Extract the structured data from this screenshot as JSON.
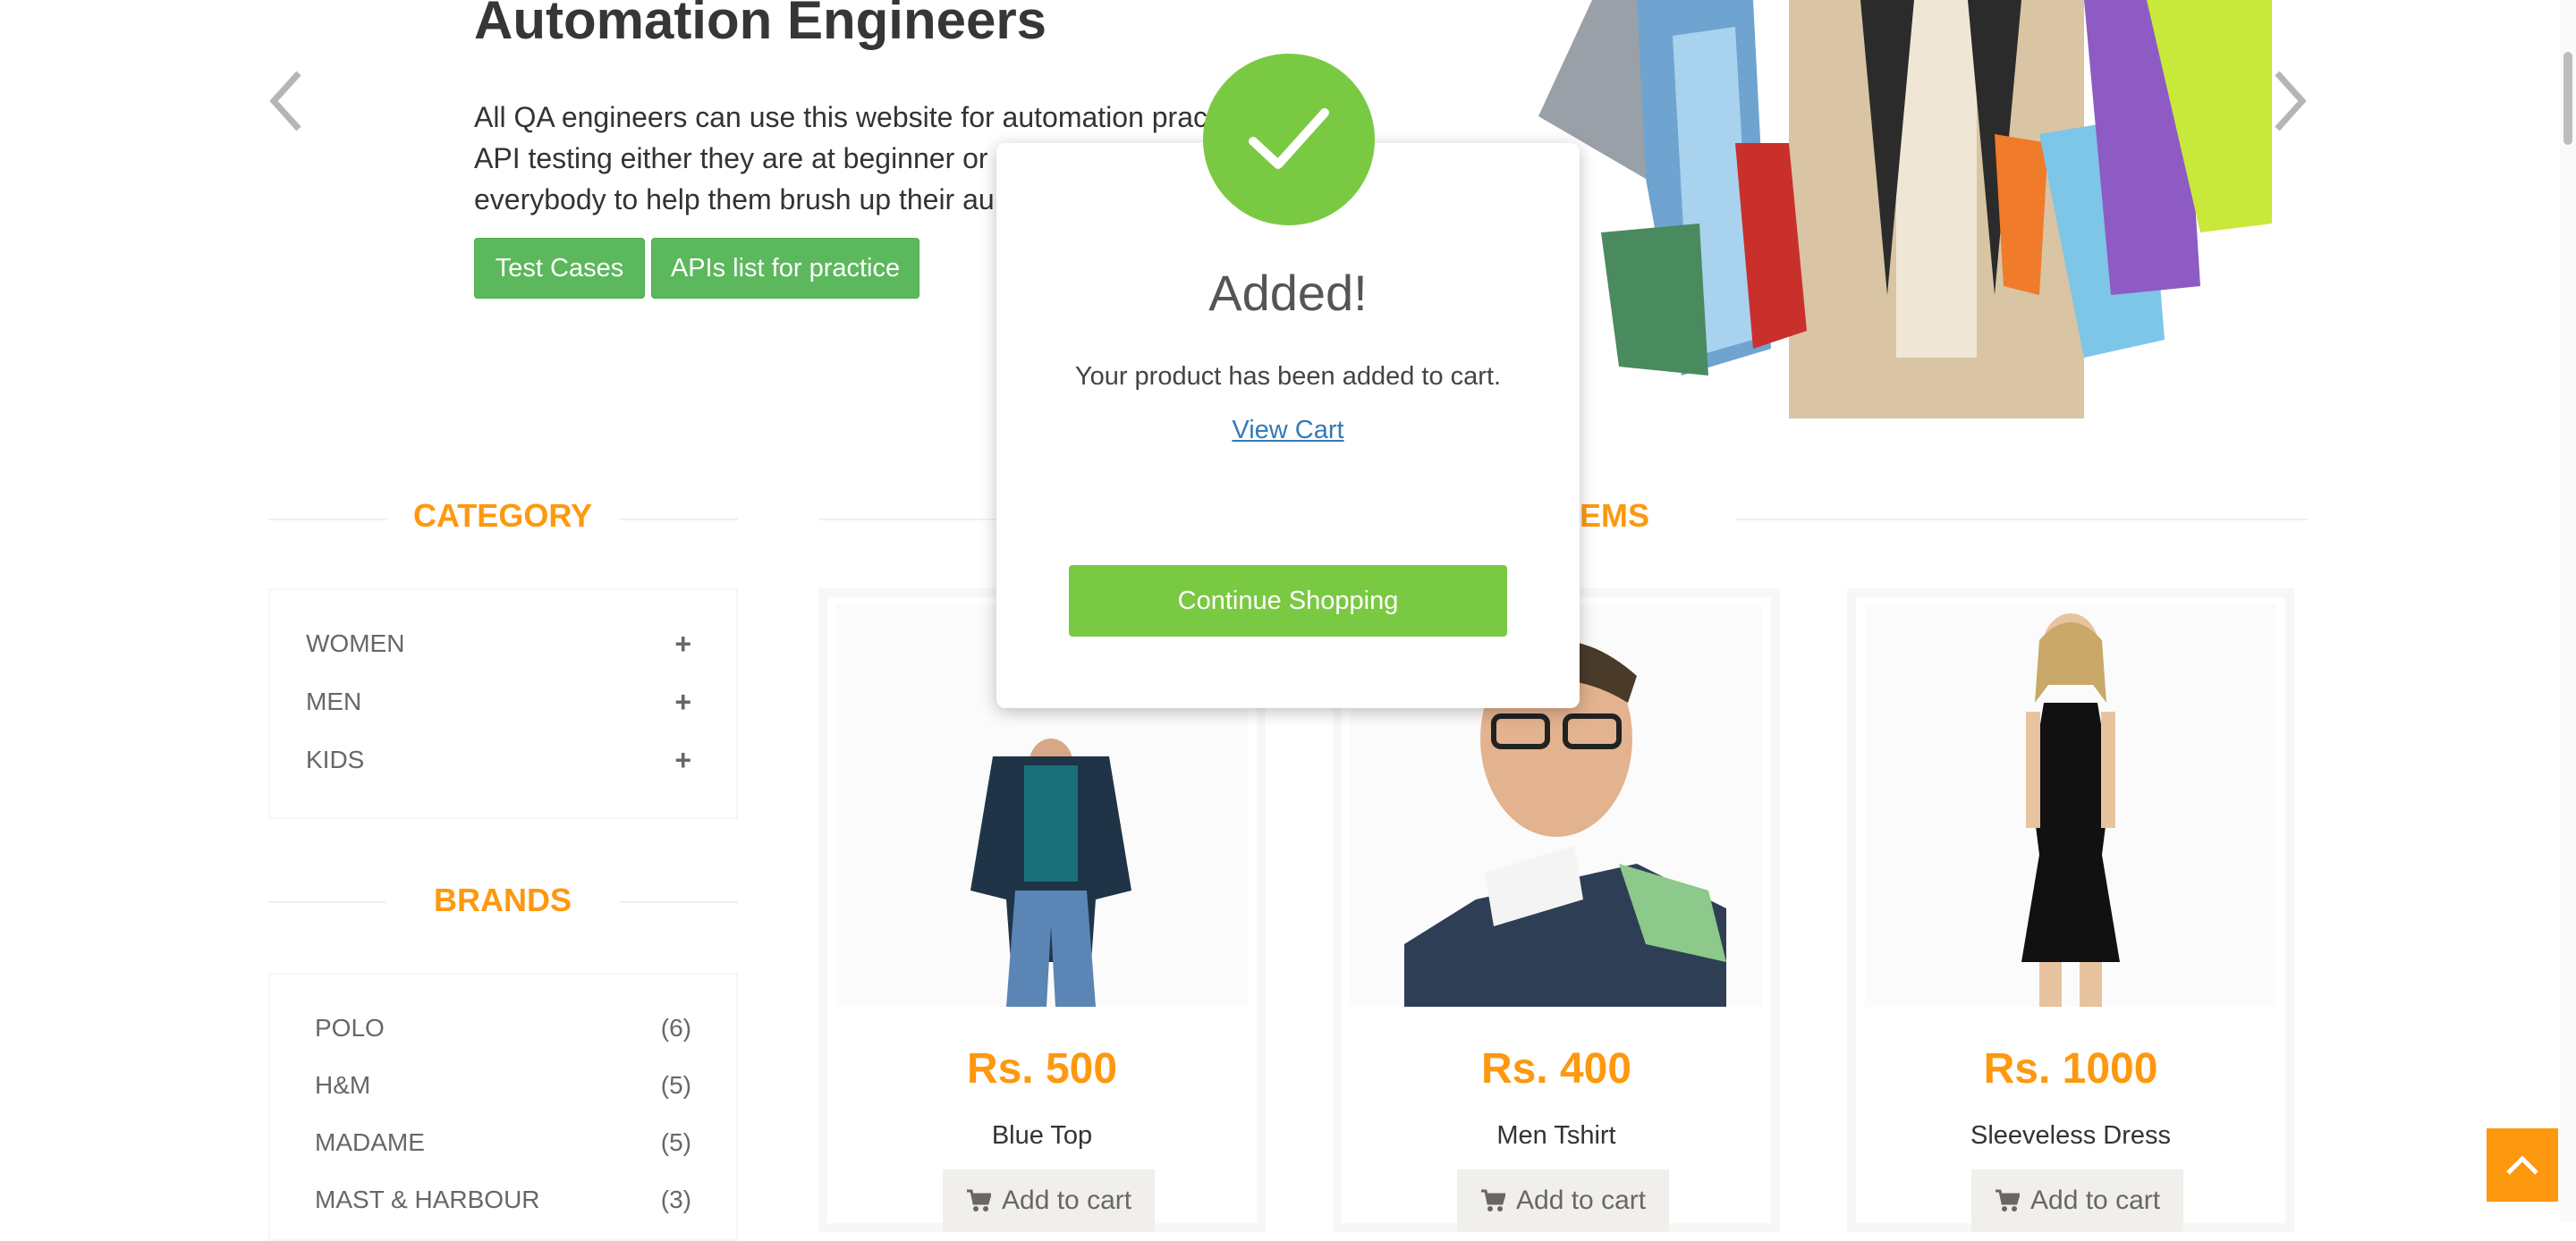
{
  "hero": {
    "title": "Automation Engineers",
    "lines": [
      "All QA engineers can use this website for automation prac",
      "API testing either they are at beginner or",
      "everybody to help them brush up their au"
    ],
    "btn_test_cases": "Test Cases",
    "btn_apis": "APIs list for practice"
  },
  "sidebar": {
    "category_title": "CATEGORY",
    "categories": [
      {
        "label": "WOMEN",
        "icon": "+"
      },
      {
        "label": "MEN",
        "icon": "+"
      },
      {
        "label": "KIDS",
        "icon": "+"
      }
    ],
    "brands_title": "BRANDS",
    "brands": [
      {
        "label": "POLO",
        "count": "(6)"
      },
      {
        "label": "H&M",
        "count": "(5)"
      },
      {
        "label": "MADAME",
        "count": "(5)"
      },
      {
        "label": "MAST & HARBOUR",
        "count": "(3)"
      }
    ]
  },
  "features": {
    "title_fragment": "S ITEMS"
  },
  "products": [
    {
      "price": "Rs. 500",
      "name": "Blue Top",
      "add_label": "Add to cart"
    },
    {
      "price": "Rs. 400",
      "name": "Men Tshirt",
      "add_label": "Add to cart"
    },
    {
      "price": "Rs. 1000",
      "name": "Sleeveless Dress",
      "add_label": "Add to cart"
    }
  ],
  "modal": {
    "title": "Added!",
    "message": "Your product has been added to cart.",
    "link": "View Cart",
    "button": "Continue Shopping"
  },
  "colors": {
    "accent_orange": "#fe980f",
    "green_button": "#5cb85c",
    "modal_green": "#7ac943",
    "link_blue": "#337ab7"
  },
  "icons": {
    "prev": "chevron-left-icon",
    "next": "chevron-right-icon",
    "success": "checkmark-icon",
    "cart": "cart-icon",
    "scroll_up": "chevron-up-icon"
  }
}
